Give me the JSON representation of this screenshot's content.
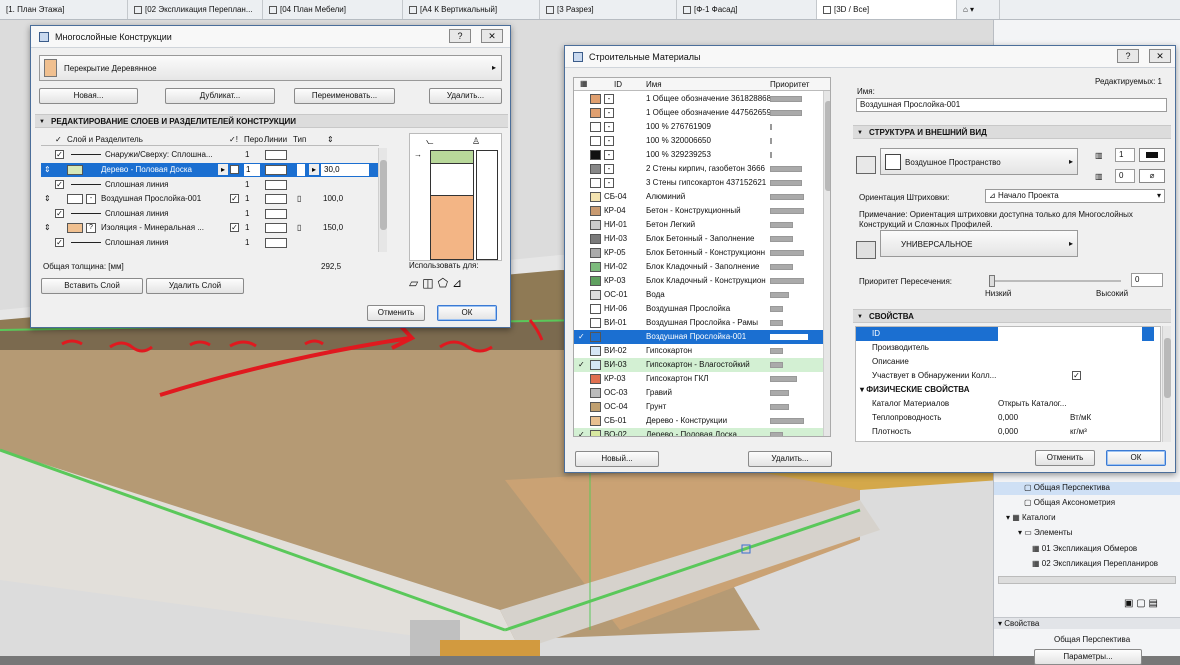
{
  "tabs": [
    {
      "label": "[1. План Этажа]"
    },
    {
      "label": "[02 Экспликация Переплан..."
    },
    {
      "label": "[04 План Мебели]"
    },
    {
      "label": "[А4 К Вертикальный]"
    },
    {
      "label": "[3 Разрез]"
    },
    {
      "label": "[Ф-1 Фасад]"
    },
    {
      "label": "[3D / Все]"
    }
  ],
  "composites": {
    "title": "Многослойные Конструкции",
    "selected": "Перекрытие Деревянное",
    "buttons": {
      "new": "Новая...",
      "duplicate": "Дубликат...",
      "rename": "Переименовать...",
      "delete": "Удалить..."
    },
    "section": "РЕДАКТИРОВАНИЕ СЛОЕВ И РАЗДЕЛИТЕЛЕЙ КОНСТРУКЦИИ",
    "columns": {
      "layer": "Слой и Разделитель",
      "pen": "Перо",
      "lines": "Линии",
      "type": "Тип"
    },
    "rows": [
      {
        "label": "Снаружи/Сверху: Сплошна...",
        "pen": "1",
        "thick": ""
      },
      {
        "label": "Дерево - Половая Доска",
        "pen": "1",
        "thick": "30,0"
      },
      {
        "label": "Сплошная линия",
        "pen": "1",
        "thick": ""
      },
      {
        "label": "Воздушная Прослойка-001",
        "pen": "1",
        "thick": "100,0"
      },
      {
        "label": "Сплошная линия",
        "pen": "1",
        "thick": ""
      },
      {
        "label": "Изоляция - Минеральная ...",
        "pen": "1",
        "thick": "150,0"
      },
      {
        "label": "Сплошная линия",
        "pen": "1",
        "thick": ""
      }
    ],
    "total_label": "Общая толщина: [мм]",
    "total_value": "292,5",
    "use_for": "Использовать для:",
    "insert_layer": "Вставить Слой",
    "delete_layer": "Удалить Слой",
    "cancel": "Отменить",
    "ok": "ОК"
  },
  "materials": {
    "title": "Строительные Материалы",
    "col_id": "ID",
    "col_name": "Имя",
    "col_priority": "Приоритет",
    "rows": [
      {
        "color": "#e0a070",
        "id": "-",
        "name": "1 Общее обозначение 361828868",
        "prio": 0.75
      },
      {
        "color": "#e0a070",
        "id": "-",
        "name": "1 Общее обозначение 447562659",
        "prio": 0.75
      },
      {
        "color": "#ffffff",
        "id": "-",
        "name": "100 % 276761909",
        "prio": 0.05
      },
      {
        "color": "#ffffff",
        "id": "-",
        "name": "100 % 320006650",
        "prio": 0.05
      },
      {
        "color": "#111111",
        "id": "-",
        "name": "100 % 329239253",
        "prio": 0.05
      },
      {
        "color": "#888888",
        "id": "-",
        "name": "2 Стены кирпич, газобетон 3666",
        "prio": 0.75
      },
      {
        "color": "#ffffff",
        "id": "-",
        "name": "3 Стены гипсокартон 437152621",
        "prio": 0.75
      },
      {
        "color": "#f3e3b0",
        "id": "СБ-04",
        "name": "Алюминий",
        "prio": 0.8
      },
      {
        "color": "#c89a70",
        "id": "КР-04",
        "name": "Бетон - Конструкционный",
        "prio": 0.8
      },
      {
        "color": "#cccccc",
        "id": "НИ-01",
        "name": "Бетон Легкий",
        "prio": 0.55
      },
      {
        "color": "#7a7a7a",
        "id": "НИ-03",
        "name": "Блок Бетонный - Заполнение",
        "prio": 0.55
      },
      {
        "color": "#aaaaaa",
        "id": "КР-05",
        "name": "Блок Бетонный - Конструкционн",
        "prio": 0.8
      },
      {
        "color": "#7dbb7d",
        "id": "НИ-02",
        "name": "Блок Кладочный - Заполнение",
        "prio": 0.55
      },
      {
        "color": "#5fa05f",
        "id": "КР-03",
        "name": "Блок Кладочный - Конструкцион",
        "prio": 0.8
      },
      {
        "color": "#dddddd",
        "id": "ОС-01",
        "name": "Вода",
        "prio": 0.45
      },
      {
        "color": "#ffffff",
        "id": "НИ-06",
        "name": "Воздушная Прослойка",
        "prio": 0.3
      },
      {
        "color": "#ffffff",
        "id": "ВИ-01",
        "name": "Воздушная Прослойка - Рамы",
        "prio": 0.3
      },
      {
        "color": "#1b6fd1",
        "id": "",
        "name": "Воздушная Прослойка-001",
        "prio": 0.9
      },
      {
        "color": "#d6e6f5",
        "id": "ВИ-02",
        "name": "Гипсокартон",
        "prio": 0.3
      },
      {
        "color": "#d6e6f5",
        "id": "ВИ-03",
        "name": "Гипсокартон - Влагостойкий",
        "prio": 0.3
      },
      {
        "color": "#e07050",
        "id": "КР-03",
        "name": "Гипсокартон ГКЛ",
        "prio": 0.65
      },
      {
        "color": "#bbbbbb",
        "id": "ОС-03",
        "name": "Гравий",
        "prio": 0.45
      },
      {
        "color": "#c0a070",
        "id": "ОС-04",
        "name": "Грунт",
        "prio": 0.45
      },
      {
        "color": "#e8c090",
        "id": "СБ-01",
        "name": "Дерево - Конструкции",
        "prio": 0.8
      },
      {
        "color": "#d8e8a0",
        "id": "ВО-02",
        "name": "Дерево - Половая Доска",
        "prio": 0.3
      }
    ],
    "new_button": "Новый...",
    "delete_button": "Удалить...",
    "editable": "Редактируемых: 1",
    "name_label": "Имя:",
    "name_value": "Воздушная Прослойка-001",
    "structure_header": "СТРУКТУРА И ВНЕШНИЙ ВИД",
    "fill_name": "Воздушное Пространство",
    "pen1": "1",
    "pen2": "0",
    "hatch_label": "Ориентация Штриховки:",
    "hatch_value": "Начало Проекта",
    "note": "Примечание: Ориентация штриховки доступна только для Многослойных Конструкций и Сложных Профилей.",
    "surface": "УНИВЕРСАЛЬНОЕ",
    "priority_label": "Приоритет Пересечения:",
    "priority_value": "0",
    "priority_low": "Низкий",
    "priority_high": "Высокий",
    "props_header": "СВОЙСТВА",
    "props": [
      {
        "name": "ID",
        "value": ""
      },
      {
        "name": "Производитель",
        "value": ""
      },
      {
        "name": "Описание",
        "value": ""
      },
      {
        "name": "Участвует в Обнаружении Колл...",
        "value": "✓"
      }
    ],
    "phys_header": "ФИЗИЧЕСКИЕ СВОЙСТВА",
    "phys": [
      {
        "name": "Каталог Материалов",
        "value": "Открыть Каталог...",
        "unit": ""
      },
      {
        "name": "Теплопроводность",
        "value": "0,000",
        "unit": "Вт/мК"
      },
      {
        "name": "Плотность",
        "value": "0,000",
        "unit": "кг/м³"
      }
    ],
    "cancel": "Отменить",
    "ok": "ОК"
  },
  "navigator": {
    "items": [
      {
        "label": "Общая Перспектива",
        "indent": 2
      },
      {
        "label": "Общая Аксонометрия",
        "indent": 2
      },
      {
        "label": "Каталоги",
        "indent": 1
      },
      {
        "label": "Элементы",
        "indent": 2
      },
      {
        "label": "01 Экспликация Обмеров",
        "indent": 3
      },
      {
        "label": "02 Экспликация Перепланиров",
        "indent": 3
      }
    ],
    "props_title": "Свойства",
    "view_name": "Общая Перспектива",
    "params": "Параметры..."
  }
}
